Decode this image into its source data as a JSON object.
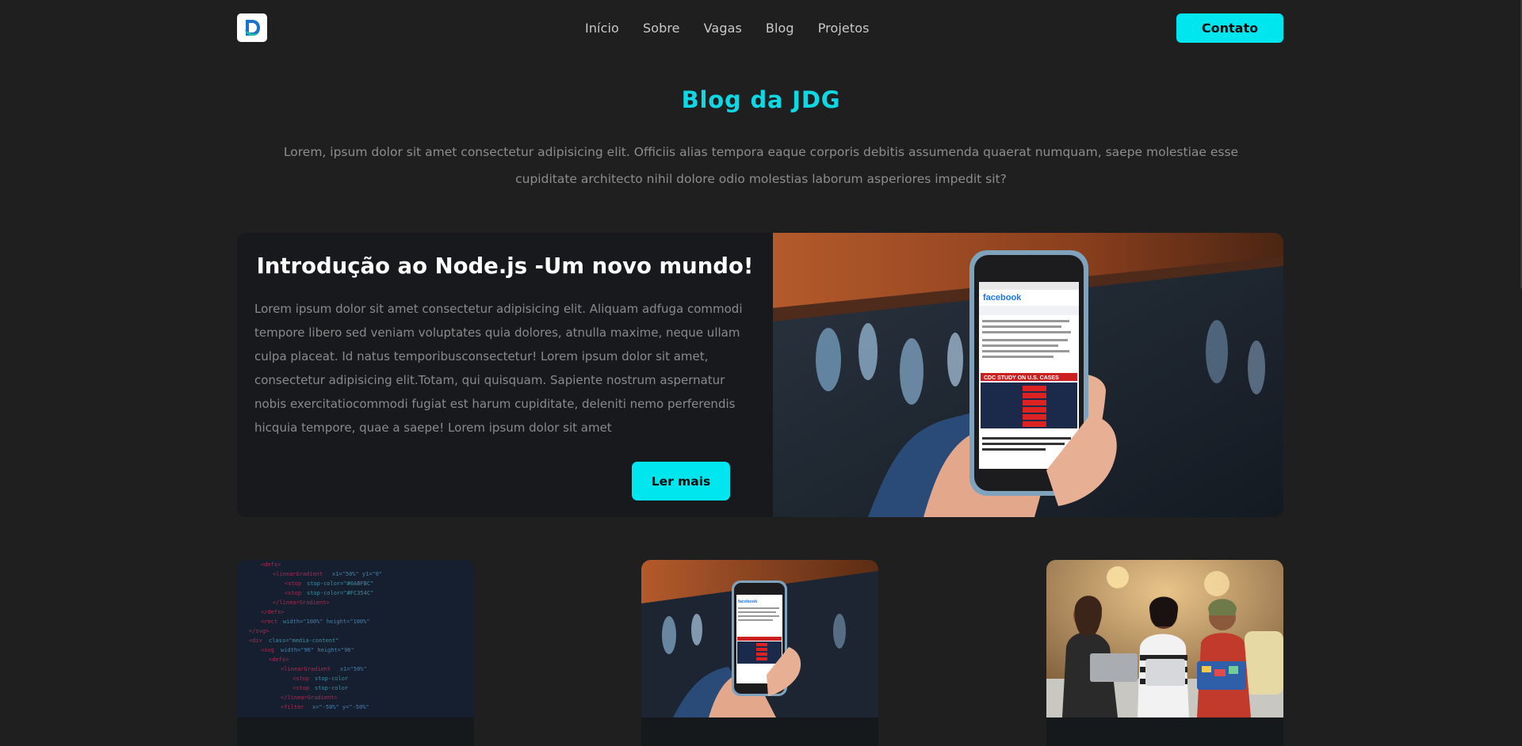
{
  "header": {
    "logo_icon": "jdg-logo-icon",
    "nav": [
      "Início",
      "Sobre",
      "Vagas",
      "Blog",
      "Projetos"
    ],
    "contact_label": "Contato"
  },
  "hero": {
    "title": "Blog da JDG",
    "intro": "Lorem, ipsum dolor sit amet consectetur adipisicing elit. Officiis alias tempora eaque corporis debitis assumenda quaerat numquam, saepe molestiae esse cupiditate architecto nihil dolore odio molestias laborum asperiores impedit sit?"
  },
  "featured": {
    "title": "Introdução ao Node.js -Um novo mundo!",
    "body": "Lorem ipsum dolor sit amet consectetur adipisicing elit. Aliquam adfuga commodi tempore libero sed veniam voluptates quia dolores, atnulla maxime, neque ullam culpa placeat. Id natus temporibusconsectetur! Lorem ipsum dolor sit amet, consectetur adipisicing elit.Totam, qui quisquam. Sapiente nostrum aspernatur nobis exercitatiocommodi fugiat est harum cupiditate, deleniti nemo perferendis hicquia tempore, quae a saepe! Lorem ipsum dolor sit amet",
    "read_more_label": "Ler mais",
    "image": "hand-holding-phone-facebook-image"
  },
  "cards": [
    {
      "image": "code-editor-image"
    },
    {
      "image": "hand-holding-phone-image"
    },
    {
      "image": "women-with-laptops-image"
    }
  ],
  "colors": {
    "background": "#1f1f1f",
    "card_background": "#17191c",
    "accent": "#00e6ef",
    "title_accent": "#0fd7e4",
    "muted_text": "#8d8d8d"
  }
}
